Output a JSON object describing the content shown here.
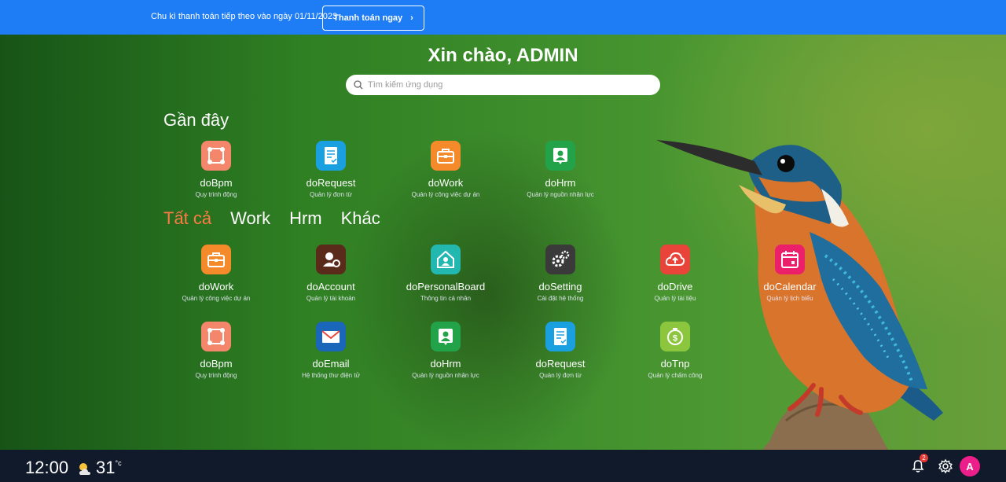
{
  "banner": {
    "text": "Chu kì thanh toán tiếp theo vào ngày 01/11/2023",
    "pay_label": "Thanh toán ngay",
    "pay_arrow": "›"
  },
  "greeting": "Xin chào, ADMIN",
  "search": {
    "placeholder": "Tìm kiếm ứng dụng",
    "value": ""
  },
  "recent": {
    "title": "Gần đây",
    "apps": [
      {
        "name": "doBpm",
        "desc": "Quy trình động",
        "icon": "bpm-icon",
        "color": "#f4866b"
      },
      {
        "name": "doRequest",
        "desc": "Quản lý đơn từ",
        "icon": "request-icon",
        "color": "#1aa0e0"
      },
      {
        "name": "doWork",
        "desc": "Quản lý công việc dự án",
        "icon": "briefcase-icon",
        "color": "#f58a2a"
      },
      {
        "name": "doHrm",
        "desc": "Quản lý nguồn nhân lực",
        "icon": "hrm-icon",
        "color": "#22a34a"
      }
    ]
  },
  "tabs": [
    "Tất cả",
    "Work",
    "Hrm",
    "Khác"
  ],
  "apps": [
    {
      "name": "doWork",
      "desc": "Quản lý công việc dự án",
      "icon": "briefcase-icon",
      "color": "#f58a2a"
    },
    {
      "name": "doAccount",
      "desc": "Quản lý tài khoản",
      "icon": "account-icon",
      "color": "#5a2a1a"
    },
    {
      "name": "doPersonalBoard",
      "desc": "Thông tin cá nhân",
      "icon": "home-user-icon",
      "color": "#22b8b0"
    },
    {
      "name": "doSetting",
      "desc": "Cài đặt hệ thống",
      "icon": "settings-icon",
      "color": "#3a3a3a"
    },
    {
      "name": "doDrive",
      "desc": "Quản lý tài liệu",
      "icon": "cloud-upload-icon",
      "color": "#e8443a"
    },
    {
      "name": "doCalendar",
      "desc": "Quản lý lịch biểu",
      "icon": "calendar-icon",
      "color": "#ec1f6a"
    },
    {
      "name": "doBpm",
      "desc": "Quy trình động",
      "icon": "bpm-icon",
      "color": "#f4866b"
    },
    {
      "name": "doEmail",
      "desc": "Hệ thống thư điện tử",
      "icon": "email-icon",
      "color": "#1a66b8"
    },
    {
      "name": "doHrm",
      "desc": "Quản lý nguồn nhân lực",
      "icon": "hrm-icon",
      "color": "#22a34a"
    },
    {
      "name": "doRequest",
      "desc": "Quản lý đơn từ",
      "icon": "request-icon",
      "color": "#1aa0e0"
    },
    {
      "name": "doTnp",
      "desc": "Quản lý chấm công",
      "icon": "timer-money-icon",
      "color": "#8cc63f"
    }
  ],
  "taskbar": {
    "time": "12:00",
    "temperature": "31",
    "unit": "°c",
    "notification_count": "2",
    "avatar_letter": "A"
  }
}
